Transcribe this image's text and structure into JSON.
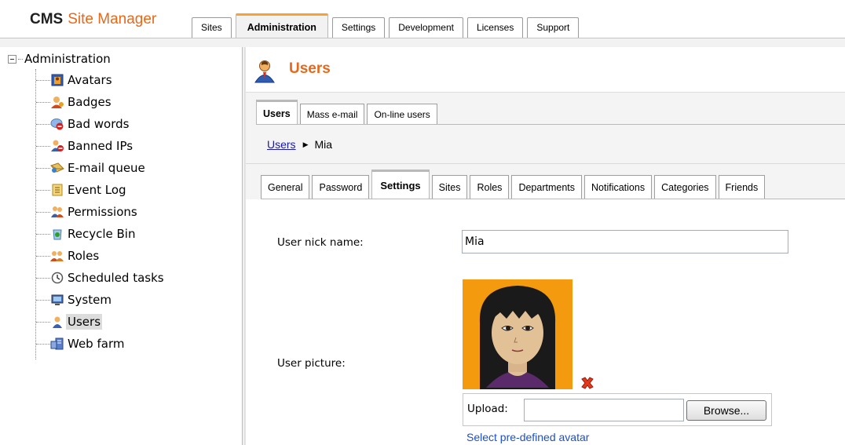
{
  "app": {
    "logo_bold": "CMS",
    "logo_rest": "Site Manager",
    "brand_color": "#e8681a",
    "accent_color": "#f7a233"
  },
  "main_tabs": [
    {
      "label": "Sites",
      "active": false
    },
    {
      "label": "Administration",
      "active": true
    },
    {
      "label": "Settings",
      "active": false
    },
    {
      "label": "Development",
      "active": false
    },
    {
      "label": "Licenses",
      "active": false
    },
    {
      "label": "Support",
      "active": false
    }
  ],
  "tree": {
    "root_label": "Administration",
    "items": [
      {
        "label": "Avatars",
        "icon": "avatars-icon",
        "selected": false
      },
      {
        "label": "Badges",
        "icon": "badges-icon",
        "selected": false
      },
      {
        "label": "Bad words",
        "icon": "bad-words-icon",
        "selected": false
      },
      {
        "label": "Banned IPs",
        "icon": "banned-ips-icon",
        "selected": false
      },
      {
        "label": "E-mail queue",
        "icon": "email-queue-icon",
        "selected": false
      },
      {
        "label": "Event Log",
        "icon": "event-log-icon",
        "selected": false
      },
      {
        "label": "Permissions",
        "icon": "permissions-icon",
        "selected": false
      },
      {
        "label": "Recycle Bin",
        "icon": "recycle-bin-icon",
        "selected": false
      },
      {
        "label": "Roles",
        "icon": "roles-icon",
        "selected": false
      },
      {
        "label": "Scheduled tasks",
        "icon": "scheduled-tasks-icon",
        "selected": false
      },
      {
        "label": "System",
        "icon": "system-icon",
        "selected": false
      },
      {
        "label": "Users",
        "icon": "users-icon",
        "selected": true
      },
      {
        "label": "Web farm",
        "icon": "web-farm-icon",
        "selected": false
      }
    ]
  },
  "page": {
    "title": "Users",
    "title_icon": "user-icon"
  },
  "sub_tabs": [
    {
      "label": "Users",
      "active": true
    },
    {
      "label": "Mass e-mail",
      "active": false
    },
    {
      "label": "On-line users",
      "active": false
    }
  ],
  "breadcrumb": {
    "link": "Users",
    "separator_icon": "triangle-right-icon",
    "current": "Mia"
  },
  "content_tabs": [
    {
      "label": "General",
      "active": false
    },
    {
      "label": "Password",
      "active": false
    },
    {
      "label": "Settings",
      "active": true
    },
    {
      "label": "Sites",
      "active": false
    },
    {
      "label": "Roles",
      "active": false
    },
    {
      "label": "Departments",
      "active": false
    },
    {
      "label": "Notifications",
      "active": false
    },
    {
      "label": "Categories",
      "active": false
    },
    {
      "label": "Friends",
      "active": false
    }
  ],
  "form": {
    "nick_label": "User nick name:",
    "nick_value": "Mia",
    "picture_label": "User picture:",
    "delete_icon": "delete-x-icon",
    "upload_label": "Upload:",
    "upload_value": "",
    "browse_label": "Browse...",
    "predefined_link": "Select pre-defined avatar"
  }
}
